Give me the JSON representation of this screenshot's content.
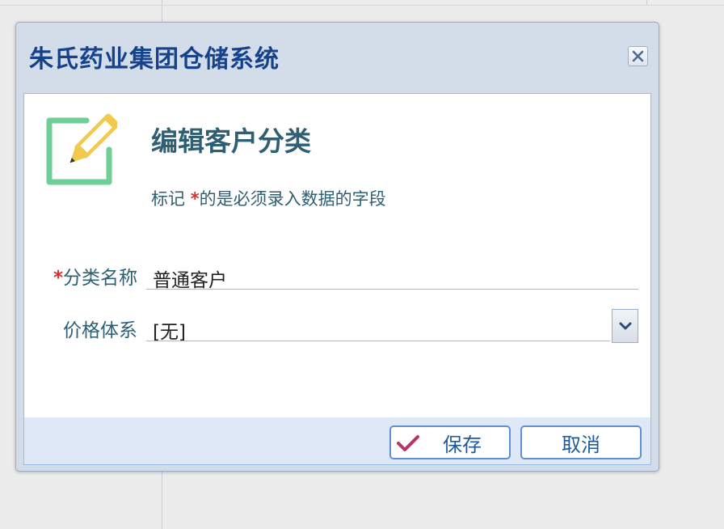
{
  "window": {
    "title": "朱氏药业集团仓储系统"
  },
  "form": {
    "title": "编辑客户分类",
    "hint_prefix": "标记 ",
    "required_mark": "*",
    "hint_suffix": "的是必须录入数据的字段",
    "fields": [
      {
        "label": "分类名称",
        "required": true,
        "value": "普通客户"
      },
      {
        "label": "价格体系",
        "required": false,
        "value": "[无]"
      }
    ]
  },
  "buttons": {
    "save_label": "保存",
    "cancel_label": "取消"
  },
  "icons": {
    "close": "close-icon",
    "edit": "edit-form-icon",
    "dropdown": "chevron-down-icon",
    "save": "checkmark-icon"
  },
  "colors": {
    "accent": "#15428b",
    "label_text": "#2e5f73",
    "required": "#d62f2f",
    "icon_green": "#6fcf97",
    "icon_yellow": "#f2c94c",
    "check_pink": "#b8336a"
  }
}
